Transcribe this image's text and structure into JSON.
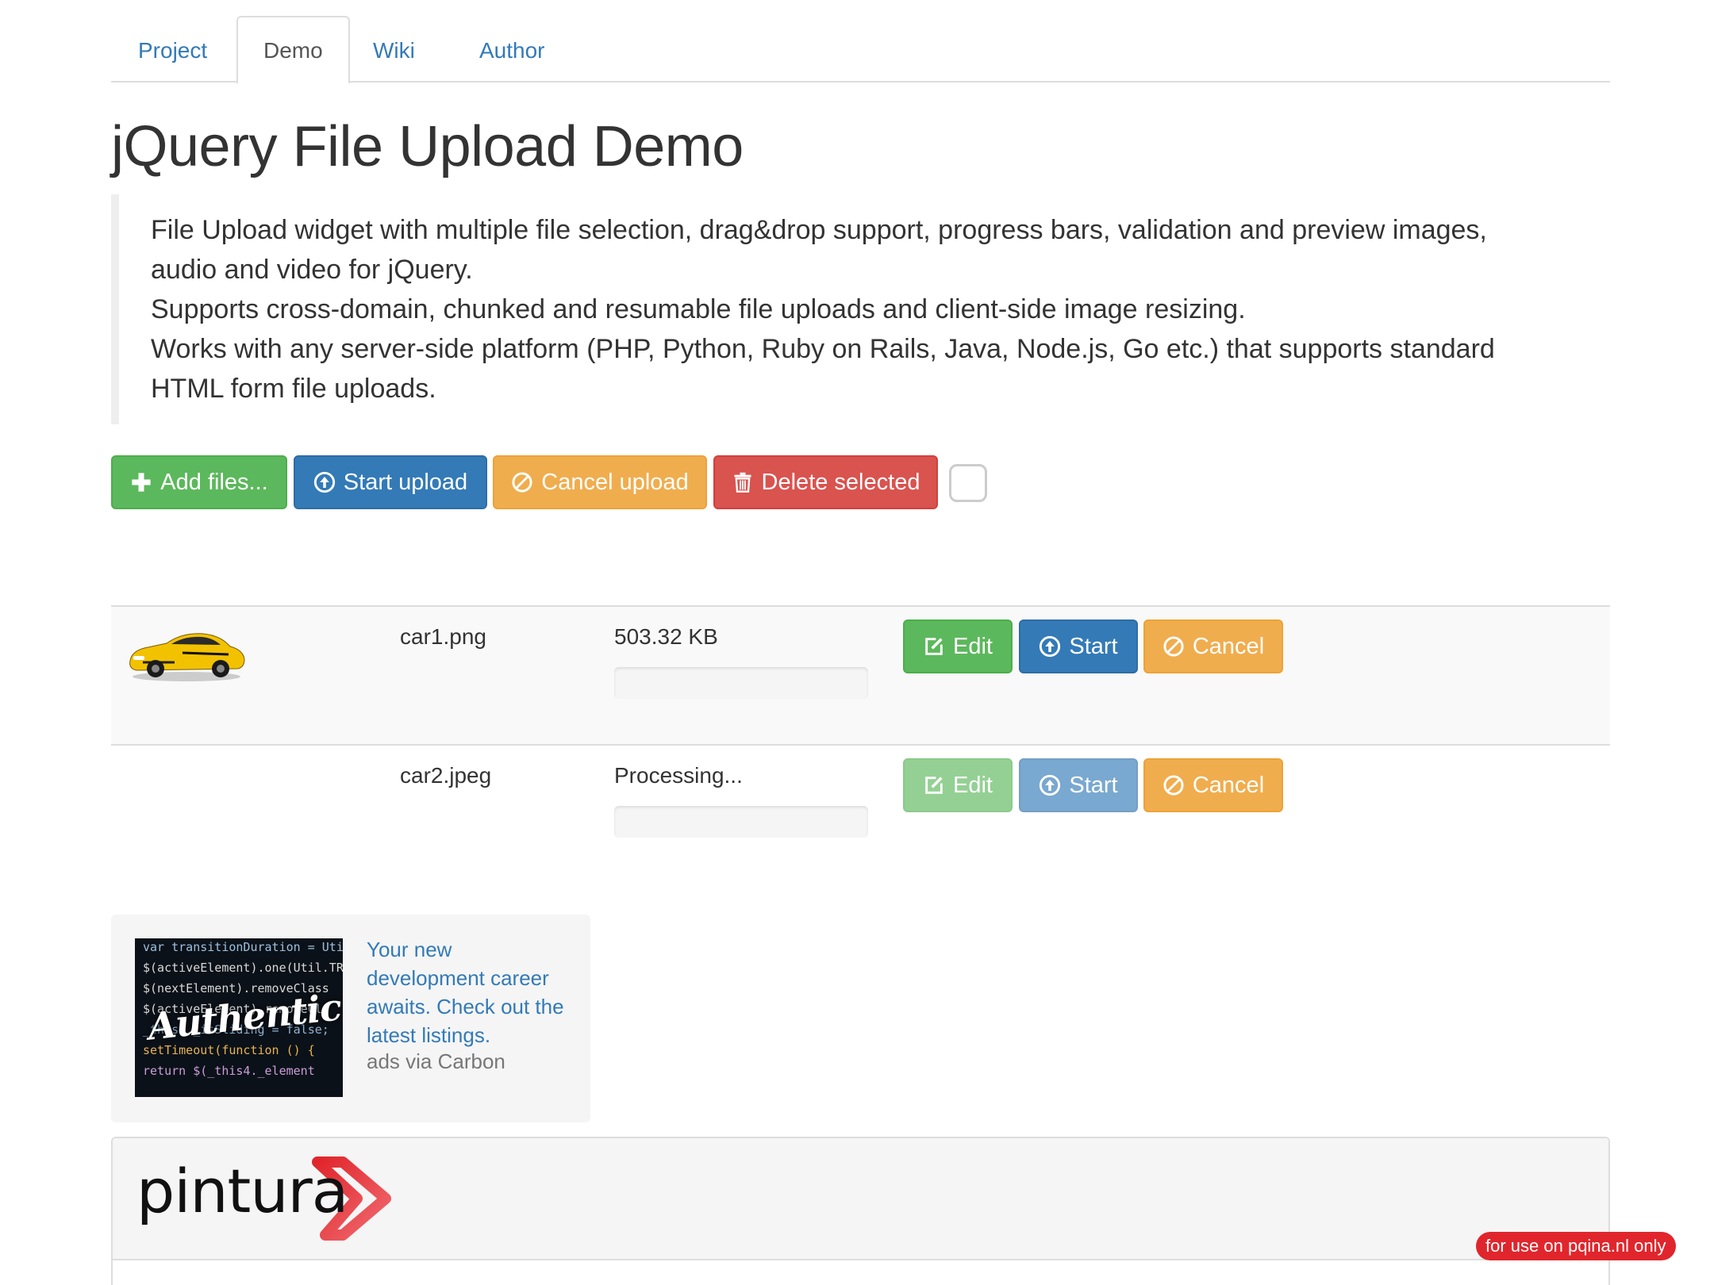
{
  "nav": {
    "tabs": [
      {
        "label": "Project",
        "active": false
      },
      {
        "label": "Demo",
        "active": true
      },
      {
        "label": "Wiki",
        "active": false
      },
      {
        "label": "Author",
        "active": false
      }
    ]
  },
  "page": {
    "title": "jQuery File Upload Demo",
    "description": [
      "File Upload widget with multiple file selection, drag&drop support, progress bars, validation and preview images, audio and video for jQuery.",
      "Supports cross-domain, chunked and resumable file uploads and client-side image resizing.",
      "Works with any server-side platform (PHP, Python, Ruby on Rails, Java, Node.js, Go etc.) that supports standard HTML form file uploads."
    ]
  },
  "toolbar": {
    "add_files": "Add files...",
    "start_upload": "Start upload",
    "cancel_upload": "Cancel upload",
    "delete_selected": "Delete selected",
    "select_all_checked": false
  },
  "files": [
    {
      "name": "car1.png",
      "status": "503.32 KB",
      "progress": 0,
      "has_thumbnail": true,
      "thumbnail_icon": "yellow-car-image",
      "edit": "Edit",
      "start": "Start",
      "cancel": "Cancel",
      "actions_enabled": true
    },
    {
      "name": "car2.jpeg",
      "status": "Processing...",
      "progress": 0,
      "has_thumbnail": false,
      "edit": "Edit",
      "start": "Start",
      "cancel": "Cancel",
      "actions_enabled": false
    }
  ],
  "ad": {
    "image_lines": [
      "var transitionDuration = Util",
      "$(activeElement).one(Util.TR",
      "$(nextElement).removeClass",
      "$(activeElement).removeCla",
      "_this4._isSliding = false;",
      "setTimeout(function () {",
      "  return $(_this4._element"
    ],
    "image_script": "Authentic",
    "text": "Your new development career awaits. Check out the latest listings.",
    "via": "ads via Carbon"
  },
  "pintura": {
    "logo_text": "pintura",
    "watermark": "for use on pqina.nl only",
    "brand_color": "#e0262c"
  },
  "colors": {
    "success": "#5cb85c",
    "primary": "#337ab7",
    "warning": "#f0ad4e",
    "danger": "#d9534f",
    "link": "#337ab7"
  }
}
